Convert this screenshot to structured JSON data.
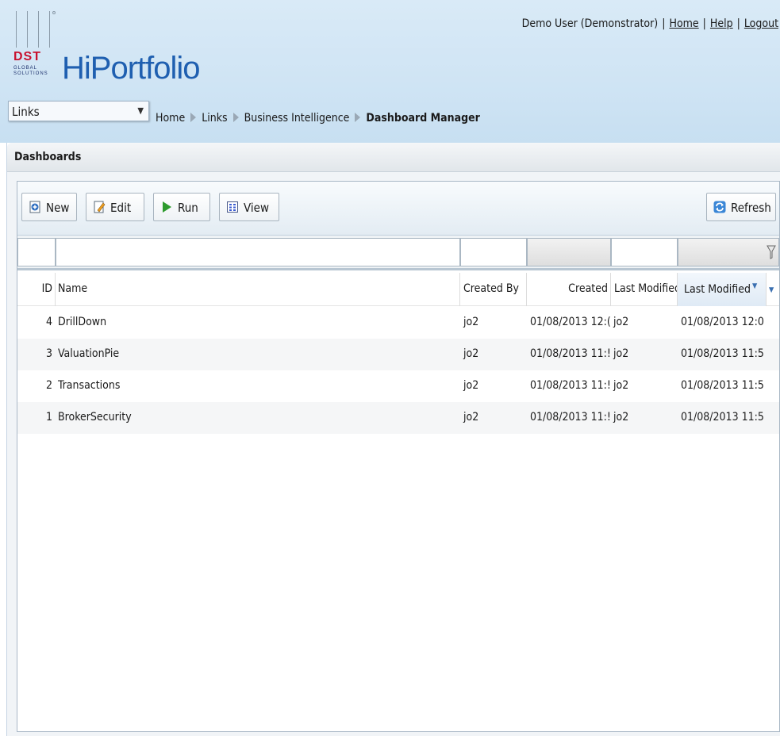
{
  "header": {
    "app_title": "HiPortfolio",
    "logo_text": "DST",
    "logo_subtext": "GLOBAL SOLUTIONS",
    "user": "Demo User (Demonstrator)",
    "links": [
      "Home",
      "Help",
      "Logout"
    ],
    "sep": "|"
  },
  "nav": {
    "links_select": "Links",
    "breadcrumb": [
      "Home",
      "Links",
      "Business Intelligence"
    ],
    "breadcrumb_current": "Dashboard Manager"
  },
  "panel": {
    "title": "Dashboards"
  },
  "toolbar": {
    "new_label": "New",
    "edit_label": "Edit",
    "run_label": "Run",
    "view_label": "View",
    "refresh_label": "Refresh"
  },
  "colors": {
    "accent_blue": "#1f5fb0",
    "run_green": "#2e9b2e",
    "header_bg": "#cfe4f4"
  },
  "table": {
    "columns": [
      "ID",
      "Name",
      "Created By",
      "Created",
      "Last Modified",
      "Last Modified"
    ],
    "sorted_column": "Last Modified",
    "sort_direction_icon": "sort-desc-icon",
    "rows": [
      {
        "id": "4",
        "name": "DrillDown",
        "created_by": "jo2",
        "created": "01/08/2013 12:(",
        "modified_by": "jo2",
        "modified": "01/08/2013 12:0"
      },
      {
        "id": "3",
        "name": "ValuationPie",
        "created_by": "jo2",
        "created": "01/08/2013 11:!",
        "modified_by": "jo2",
        "modified": "01/08/2013 11:5"
      },
      {
        "id": "2",
        "name": "Transactions",
        "created_by": "jo2",
        "created": "01/08/2013 11:!",
        "modified_by": "jo2",
        "modified": "01/08/2013 11:5"
      },
      {
        "id": "1",
        "name": "BrokerSecurity",
        "created_by": "jo2",
        "created": "01/08/2013 11:!",
        "modified_by": "jo2",
        "modified": "01/08/2013 11:5"
      }
    ]
  }
}
